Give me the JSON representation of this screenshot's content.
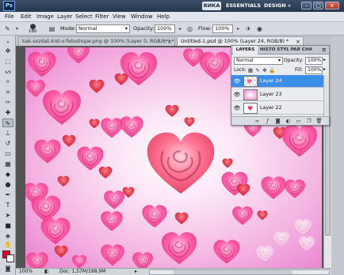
{
  "app": {
    "logo": "Ps"
  },
  "workspaces": {
    "active": "ВИКА",
    "essentials": "ESSENTIALS",
    "design": "DESIGN",
    "more": "»"
  },
  "window_controls": {
    "minimize": "–",
    "maximize": "□",
    "close": "x"
  },
  "menu": [
    "File",
    "Edit",
    "Image",
    "Layer",
    "Select",
    "Filter",
    "View",
    "Window",
    "Help"
  ],
  "options_bar": {
    "brush_size": "180",
    "mode_label": "Mode:",
    "mode_value": "Normal",
    "opacity_label": "Opacity:",
    "opacity_value": "100%",
    "flow_label": "Flow:",
    "flow_value": "100%"
  },
  "tabs": [
    {
      "label": "kak-sozdat-kist-v-fotoshope.png @ 100% (Layer 0, RGB/8*) *",
      "close": "×"
    },
    {
      "label": "Untitled-1.psd @ 100% (Layer 24, RGB/8) *",
      "close": "×"
    }
  ],
  "layers_panel": {
    "tabs": {
      "layers": "LAYERS",
      "history": "HISTO STYL PAR CHA",
      "menu": "≡"
    },
    "blend_mode": "Normal",
    "opacity_label": "Opacity:",
    "opacity_value": "100%",
    "lock_label": "Lock:",
    "fill_label": "Fill:",
    "fill_value": "100%",
    "layers": [
      {
        "name": "Layer 24",
        "selected": true,
        "visible": true
      },
      {
        "name": "Layer 23",
        "selected": false,
        "visible": true
      },
      {
        "name": "Layer 22",
        "selected": false,
        "visible": true
      }
    ],
    "footer_icons": [
      "link-icon",
      "fx-icon",
      "mask-icon",
      "adjustment-icon",
      "folder-icon",
      "new-layer-icon",
      "trash-icon"
    ]
  },
  "status": {
    "zoom": "100%",
    "doc": "Doc: 1,57M/198,9M"
  },
  "colors": {
    "foreground": "#e4002b",
    "background": "#ffffff",
    "selection": "#3a8ee6"
  }
}
